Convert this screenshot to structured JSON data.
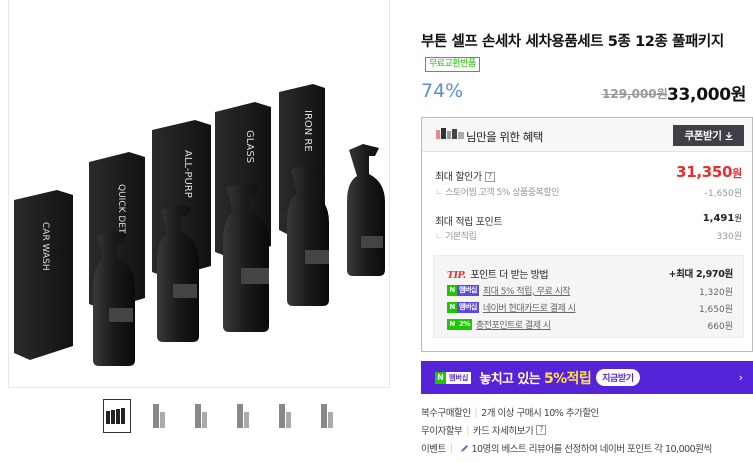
{
  "product": {
    "title": "부톤 셀프 손세차 세차용품세트 5종 12종 풀패키지",
    "badge": "무료교환반품",
    "discount": "74%",
    "original_price": "129,000원",
    "price": "33,000원"
  },
  "thumbnails": {
    "count": 6,
    "active_index": 0
  },
  "benefit": {
    "header": "님만을 위한 혜택",
    "coupon_button": "쿠폰받기",
    "max_discount_label": "최대 할인가",
    "max_discount_value": "31,350",
    "max_discount_unit": "원",
    "store_discount_label": "스토어찜 고객 5% 상품중복할인",
    "store_discount_value": "-1,650원",
    "max_points_label": "최대 적립 포인트",
    "max_points_value": "1,491",
    "max_points_unit": "원",
    "base_points_label": "기본적립",
    "base_points_value": "330원",
    "tip": {
      "prefix": "TIP.",
      "title": "포인트 더 받는 방법",
      "max": "+최대 2,970원",
      "items": [
        {
          "badge": "멤버십",
          "text": "최대 5% 적립, 무료 시작",
          "value": "1,320원"
        },
        {
          "badge": "멤버십",
          "text": "네이버 현대카드로 결제 시",
          "value": "1,650원"
        },
        {
          "badge": "2%",
          "text": "충전포인트로 결제 시",
          "value": "660원"
        }
      ]
    }
  },
  "ad": {
    "membership": "멤버십",
    "text_pre": "놓치고 있는 ",
    "text_hl": "5%적립",
    "button": "지금받기",
    "arrow": "›"
  },
  "info": {
    "bulk_label": "복수구매할인",
    "bulk_value": "2개 이상 구매시 10% 추가할인",
    "installment_label": "무이자할부",
    "installment_value": "카드 자세히보기",
    "event_label": "이벤트",
    "event_value": "10명의 베스트 리뷰어를 선정하여 네이버 포인트 각 10,000원씩"
  },
  "colors": {
    "accent_green": "#1ec800",
    "discount_blue": "#5b8ed8",
    "price_red": "#e82e2e",
    "banner_purple": "#5524d8"
  }
}
